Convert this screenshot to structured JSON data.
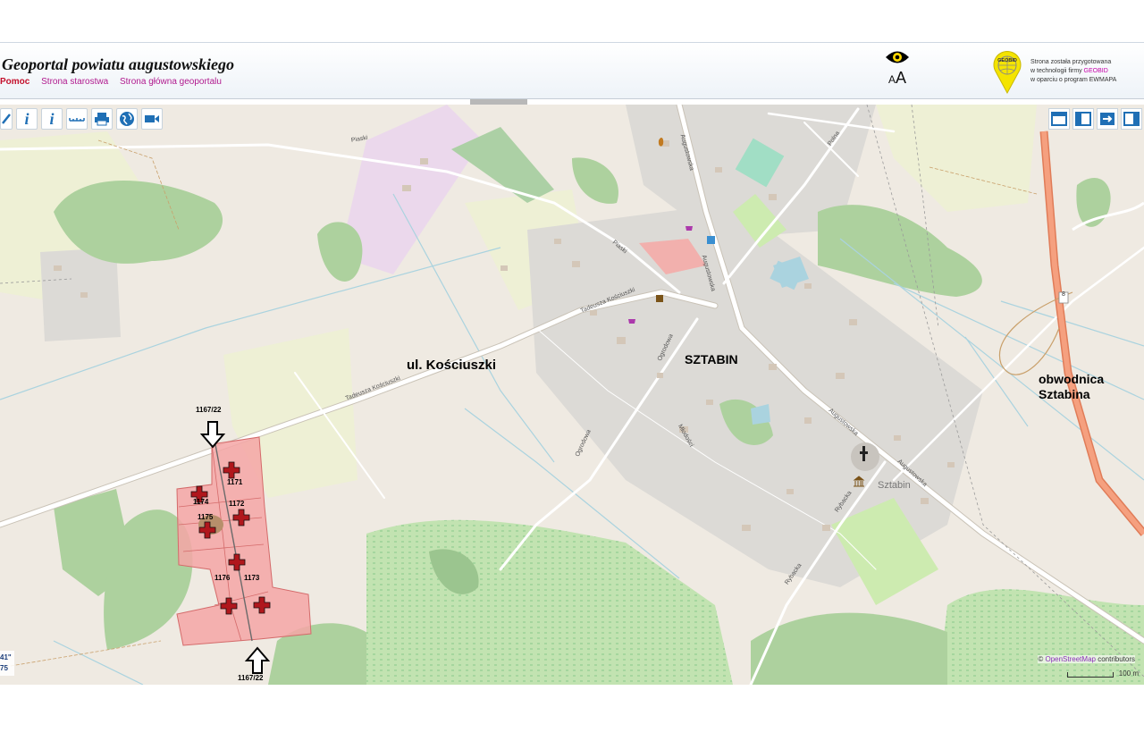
{
  "header": {
    "title": "Geoportal powiatu augustowskiego",
    "nav": [
      "Pomoc",
      "Strona starostwa",
      "Strona główna geoportalu"
    ],
    "font_size_label": {
      "small": "A",
      "large": "A"
    },
    "geobid_logo_text": "GEOBID",
    "geobid_text": {
      "line1": "Strona została przygotowana",
      "line2_prefix": "w technologii firmy",
      "line2_brand": "GEOBID",
      "line3": "w oparciu o program EWMAPA"
    }
  },
  "toolbar_left": [
    {
      "icon": "link-icon",
      "glyph": "🔗"
    },
    {
      "icon": "info-icon",
      "glyph": "i"
    },
    {
      "icon": "info-select-icon",
      "glyph": "i"
    },
    {
      "icon": "measure-icon",
      "glyph": "…"
    },
    {
      "icon": "print-icon",
      "glyph": "▤"
    },
    {
      "icon": "globe-icon",
      "glyph": "◍"
    },
    {
      "icon": "video-icon",
      "glyph": "■"
    }
  ],
  "toolbar_right": [
    "layout-top-icon",
    "layout-left-icon",
    "layout-export-icon",
    "layout-right-icon"
  ],
  "map": {
    "annotations": {
      "street": "ul. Kościuszki",
      "town": "SZTABIN",
      "bypass_line1": "obwodnica",
      "bypass_line2": "Sztabina",
      "place": "Sztabin"
    },
    "plots": {
      "top_label": "1167/22",
      "bottom_label": "1167/22",
      "numbers": [
        "1171",
        "1174",
        "1172",
        "1175",
        "1176",
        "1173"
      ]
    },
    "streets": {
      "piaski_1": "Piaski",
      "piaski_2": "Piaski",
      "kosciuszki_1": "Tadeusza Kościuszki",
      "kosciuszki_2": "Tadeusza Kościuszki",
      "ogrodowa_1": "Ogrodowa",
      "ogrodowa_2": "Ogrodowa",
      "augustowska_1": "Augustowska",
      "augustowska_2": "Augustowska",
      "augustowska_3": "Augustowska",
      "polna": "Polna",
      "mlodosci": "Młodości",
      "rybacka_1": "Rybacka",
      "rybacka_2": "Rybacka",
      "road_number": "8"
    },
    "coords": {
      "line1": "41\"",
      "line2": "75"
    },
    "attribution": {
      "symbol": "©",
      "link": "OpenStreetMap",
      "suffix": " contributors"
    },
    "scale_label": "100 m"
  },
  "colors": {
    "accent": "#b0198e",
    "plot_fill": "#f4a6a6",
    "marker": "#b0171c",
    "forest": "#add19e",
    "motorway": "#f0967a"
  }
}
